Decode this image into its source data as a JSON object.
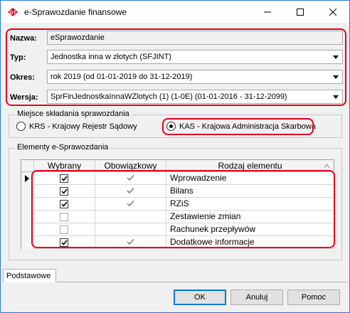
{
  "window": {
    "title": "e-Sprawozdanie finansowe",
    "icon": "app-logo-icon",
    "controls": [
      "minimize-icon",
      "maximize-icon",
      "close-icon"
    ]
  },
  "form": {
    "nazwa": {
      "label": "Nazwa:",
      "value": "eSprawozdanie"
    },
    "typ": {
      "label": "Typ:",
      "value": "Jednostka inna w złotych (SFJINT)"
    },
    "okres": {
      "label": "Okres:",
      "value": "rok 2019 (od 01-01-2019 do 31-12-2019)"
    },
    "wersja": {
      "label": "Wersja:",
      "value": "SprFinJednostkaInnaWZlotych (1) (1-0E) (01-01-2016 - 31-12-2099)"
    }
  },
  "miejsce": {
    "legend": "Miejsce składania sprawozdania",
    "options": [
      {
        "label": "KRS - Krajowy Rejestr Sądowy",
        "selected": false
      },
      {
        "label": "KAS - Krajowa Administracja Skarbowa",
        "selected": true
      }
    ]
  },
  "elementy": {
    "legend": "Elementy e-Sprawozdania",
    "columns": {
      "wybrany": "Wybrany",
      "obowiazkowy": "Obowiązkowy",
      "rodzaj": "Rodzaj elementu"
    },
    "rows": [
      {
        "name": "Wprowadzenie",
        "wybrany": true,
        "obowiazkowy": true,
        "current": true
      },
      {
        "name": "Bilans",
        "wybrany": true,
        "obowiazkowy": true,
        "current": false
      },
      {
        "name": "RZiS",
        "wybrany": true,
        "obowiazkowy": true,
        "current": false
      },
      {
        "name": "Zestawienie zmian",
        "wybrany": false,
        "obowiazkowy": false,
        "current": false
      },
      {
        "name": "Rachunek przepływów",
        "wybrany": false,
        "obowiazkowy": false,
        "current": false
      },
      {
        "name": "Dodatkowe informacje",
        "wybrany": true,
        "obowiazkowy": true,
        "current": false
      }
    ]
  },
  "tabs": [
    {
      "label": "Podstawowe"
    }
  ],
  "buttons": {
    "ok": "OK",
    "anuluj": "Anuluj",
    "pomoc": "Pomoc"
  },
  "colors": {
    "highlight": "#e3001b",
    "window_border": "#2b78d4",
    "check_gray": "#8a8a8a"
  }
}
